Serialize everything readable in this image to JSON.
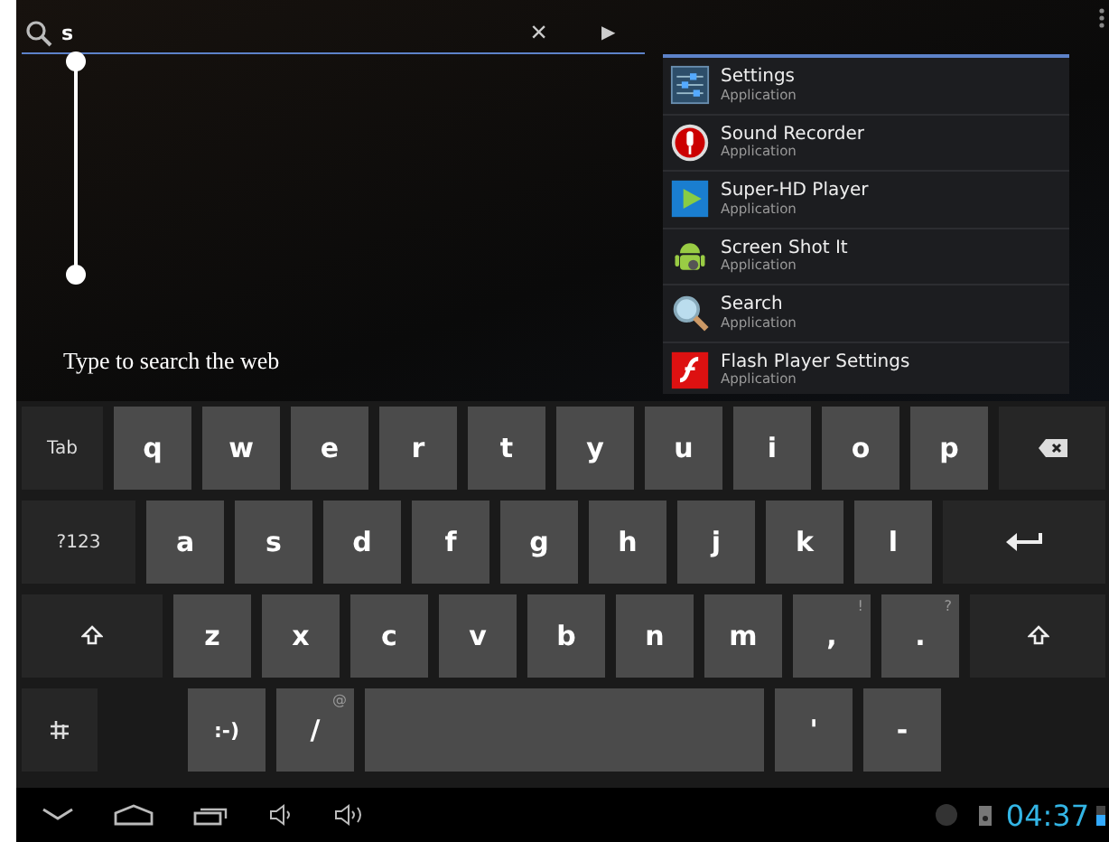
{
  "search": {
    "value": "s",
    "clear": "×",
    "go": "▶"
  },
  "hint": "Type to search the web",
  "suggestions": [
    {
      "title": "Settings",
      "subtitle": "Application"
    },
    {
      "title": "Sound Recorder",
      "subtitle": "Application"
    },
    {
      "title": "Super-HD Player",
      "subtitle": "Application"
    },
    {
      "title": "Screen Shot It",
      "subtitle": "Application"
    },
    {
      "title": "Search",
      "subtitle": "Application"
    },
    {
      "title": "Flash Player Settings",
      "subtitle": "Application"
    }
  ],
  "keyboard": [
    [
      {
        "kind": "tab",
        "label": "Tab"
      },
      {
        "kind": "letter",
        "label": "q"
      },
      {
        "kind": "letter",
        "label": "w"
      },
      {
        "kind": "letter",
        "label": "e"
      },
      {
        "kind": "letter",
        "label": "r"
      },
      {
        "kind": "letter",
        "label": "t"
      },
      {
        "kind": "letter",
        "label": "y"
      },
      {
        "kind": "letter",
        "label": "u"
      },
      {
        "kind": "letter",
        "label": "i"
      },
      {
        "kind": "letter",
        "label": "o"
      },
      {
        "kind": "letter",
        "label": "p"
      },
      {
        "kind": "backspace"
      }
    ],
    [
      {
        "kind": "symbols",
        "label": "?123"
      },
      {
        "kind": "letter",
        "label": "a"
      },
      {
        "kind": "letter",
        "label": "s"
      },
      {
        "kind": "letter",
        "label": "d"
      },
      {
        "kind": "letter",
        "label": "f"
      },
      {
        "kind": "letter",
        "label": "g"
      },
      {
        "kind": "letter",
        "label": "h"
      },
      {
        "kind": "letter",
        "label": "j"
      },
      {
        "kind": "letter",
        "label": "k"
      },
      {
        "kind": "letter",
        "label": "l"
      },
      {
        "kind": "enter"
      }
    ],
    [
      {
        "kind": "shift"
      },
      {
        "kind": "letter",
        "label": "z"
      },
      {
        "kind": "letter",
        "label": "x"
      },
      {
        "kind": "letter",
        "label": "c"
      },
      {
        "kind": "letter",
        "label": "v"
      },
      {
        "kind": "letter",
        "label": "b"
      },
      {
        "kind": "letter",
        "label": "n"
      },
      {
        "kind": "letter",
        "label": "m"
      },
      {
        "kind": "letter",
        "label": ",",
        "hint": "!"
      },
      {
        "kind": "letter",
        "label": ".",
        "hint": "?"
      },
      {
        "kind": "shift-right"
      }
    ],
    [
      {
        "kind": "settings"
      },
      {
        "kind": "smiley",
        "label": ":-)"
      },
      {
        "kind": "letter",
        "label": "/",
        "hint": "@"
      },
      {
        "kind": "space"
      },
      {
        "kind": "letter",
        "label": "'"
      },
      {
        "kind": "letter",
        "label": "-"
      }
    ]
  ],
  "clock": "04:37"
}
